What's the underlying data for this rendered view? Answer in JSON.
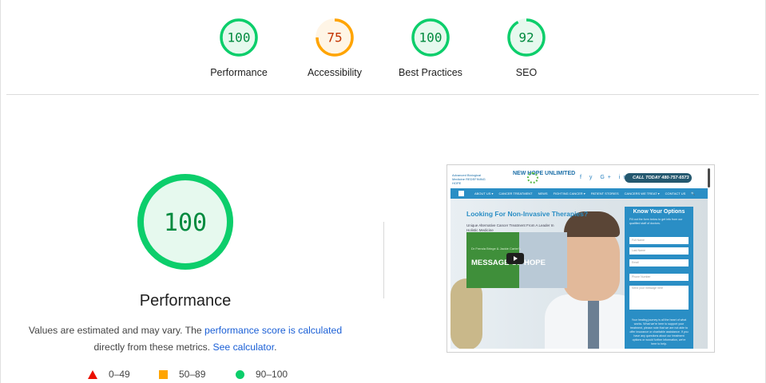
{
  "categories": [
    {
      "label": "Performance",
      "score": "100",
      "value": 100,
      "color": "#0cce6b",
      "fill": "#e6f9ee",
      "text_color": "#008a3e"
    },
    {
      "label": "Accessibility",
      "score": "75",
      "value": 75,
      "color": "#ffa400",
      "fill": "#fff5e6",
      "text_color": "#c33300"
    },
    {
      "label": "Best Practices",
      "score": "100",
      "value": 100,
      "color": "#0cce6b",
      "fill": "#e6f9ee",
      "text_color": "#008a3e"
    },
    {
      "label": "SEO",
      "score": "92",
      "value": 92,
      "color": "#0cce6b",
      "fill": "#e6f9ee",
      "text_color": "#008a3e"
    }
  ],
  "main": {
    "score": "100",
    "value": 100,
    "title": "Performance",
    "desc_prefix": "Values are estimated and may vary. The ",
    "desc_link1": "performance score is calculated",
    "desc_middle": " directly from these metrics. ",
    "desc_link2": "See calculator",
    "desc_suffix": "."
  },
  "legend": [
    {
      "range": "0–49",
      "shape": "triangle",
      "color": "#eb0f00"
    },
    {
      "range": "50–89",
      "shape": "square",
      "color": "#ffa400"
    },
    {
      "range": "90–100",
      "shape": "circle",
      "color": "#0cce6b"
    }
  ],
  "thumbnail": {
    "logo_small": "Advanced Biological Medicine REDEFINING HOPE",
    "logo_brand": "NEW HOPE UNLIMITED",
    "social_icons": "f  y  G+  in",
    "call_text": "CALL TODAY 480-757-6573",
    "nav": [
      "ABOUT US ▾",
      "CANCER TREATMENT",
      "NEWS",
      "FIGHTING CANCER ▾",
      "PATIENT STORIES",
      "CANCERS WE TREAT ▾",
      "CONTACT US",
      "🔍"
    ],
    "hero_title": "Looking For Non-Invasive Therapies?",
    "hero_sub": "Unique Alternative Cancer Treatment From A Leader In Holistic Medicine",
    "video_names": "Dr Frenda Bringe & Jackie Carter's",
    "video_title": "MESSAGE OF HOPE",
    "form_title": "Know Your Options",
    "form_sub": "Fill out the form below to get info from our qualified staff of doctors.",
    "fields": [
      "Full Name",
      "Last Name",
      "Email",
      "Phone Number",
      "Send your message here"
    ],
    "form_foot": "Your healing journey is all the heart of what works. What we're here to support your treatment, please note that we are not able to offer insurance or charitable assistance. If you have any questions about our treatment options or would further information, we're here to help."
  }
}
